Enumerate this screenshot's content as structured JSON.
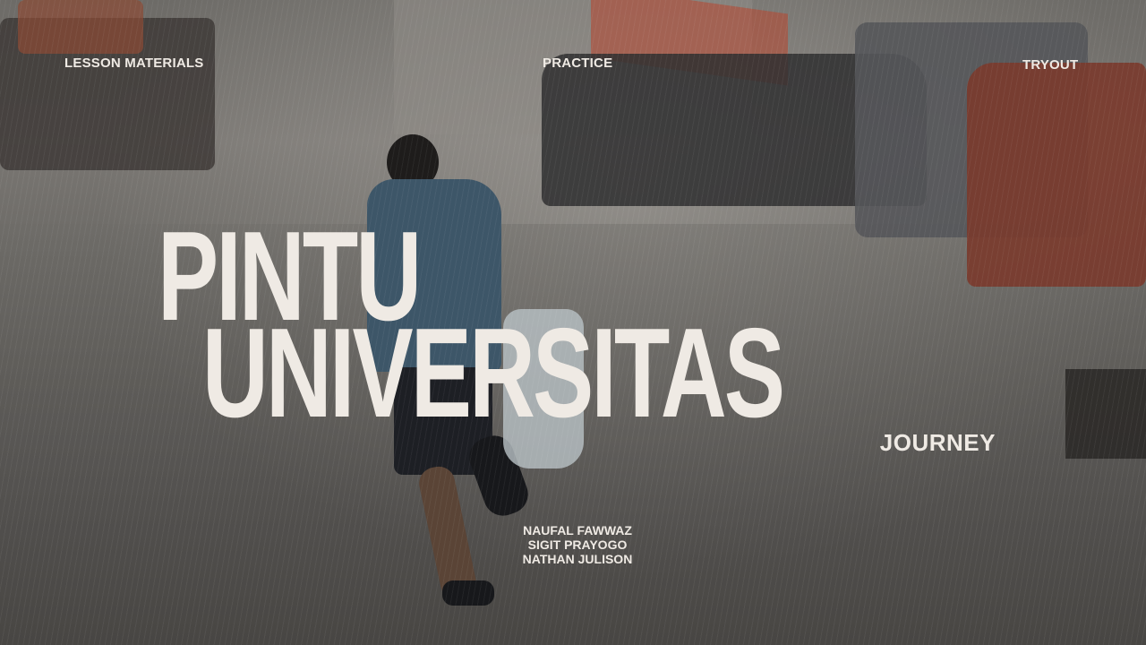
{
  "nav": {
    "lesson_materials": "LESSON MATERIALS",
    "practice": "PRACTICE",
    "tryout": "TRYOUT"
  },
  "hero": {
    "title_line1": "PINTU",
    "title_line2": "UNIVERSITAS",
    "subtitle": "JOURNEY"
  },
  "authors": [
    "NAUFAL FAWWAZ",
    "SIGIT PRAYOGO",
    "NATHAN JULISON"
  ],
  "colors": {
    "text": "#efeae4",
    "background": "#6d6b67",
    "accent_red": "#b8452e"
  }
}
